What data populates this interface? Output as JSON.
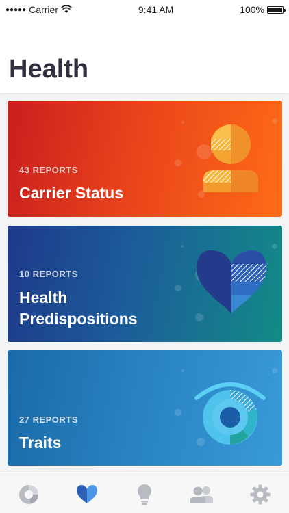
{
  "status_bar": {
    "signal_dots": "●●●●●",
    "carrier": "Carrier",
    "time": "9:41 AM",
    "battery_text": "100%",
    "battery_level": 1.0
  },
  "header": {
    "title": "Health"
  },
  "cards": [
    {
      "count": "43 REPORTS",
      "title": "Carrier Status",
      "icon": "person-icon",
      "colors": [
        "#c81e1e",
        "#ff6b17"
      ]
    },
    {
      "count": "10 REPORTS",
      "title": "Health Predispositions",
      "icon": "heart-icon",
      "colors": [
        "#1e3a8a",
        "#138b86"
      ]
    },
    {
      "count": "27 REPORTS",
      "title": "Traits",
      "icon": "eye-icon",
      "colors": [
        "#1a6aa8",
        "#3a9ad8"
      ]
    }
  ],
  "tab_bar": {
    "tabs": [
      {
        "icon": "ancestry-pie-icon",
        "active": false
      },
      {
        "icon": "heart-icon",
        "active": true
      },
      {
        "icon": "lightbulb-icon",
        "active": false
      },
      {
        "icon": "people-icon",
        "active": false
      },
      {
        "icon": "gear-icon",
        "active": false
      }
    ],
    "active_color": "#3b7fd6",
    "inactive_color": "#b9bcc2"
  }
}
